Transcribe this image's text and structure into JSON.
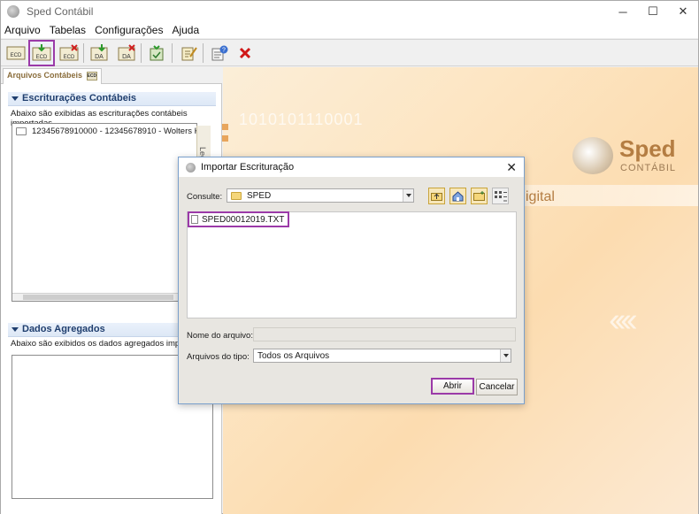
{
  "window": {
    "title": "Sped Contábil",
    "minimize": "─",
    "maximize": "☐",
    "close": "✕"
  },
  "menu": [
    {
      "label": "Arquivo"
    },
    {
      "label": "Tabelas"
    },
    {
      "label": "Configurações"
    },
    {
      "label": "Ajuda"
    }
  ],
  "toolbar": {
    "buttons": [
      {
        "name": "ecd",
        "label": "ECD"
      },
      {
        "name": "ecd-import",
        "label": "ECD"
      },
      {
        "name": "ecd-delete",
        "label": "ECD"
      },
      {
        "name": "da-import",
        "label": "DA"
      },
      {
        "name": "da-delete",
        "label": "DA"
      },
      {
        "name": "validate",
        "label": ""
      },
      {
        "name": "sign",
        "label": ""
      },
      {
        "name": "report",
        "label": ""
      },
      {
        "name": "remove",
        "label": ""
      }
    ]
  },
  "left_panel": {
    "tab_label": "Arquivos Contábeis",
    "tab_badge": "ECD",
    "escrituracoes": {
      "title": "Escriturações Contábeis",
      "description": "Abaixo são exibidas as escriturações contábeis importadas.",
      "items": [
        {
          "text": "12345678910000 - 12345678910 - Wolters Klu"
        }
      ]
    },
    "dados_agregados": {
      "title": "Dados Agregados",
      "description": "Abaixo são exibidos os dados agregados importa"
    },
    "side_handle": "Legenda"
  },
  "right_panel": {
    "binary": "1010101110001",
    "logo_main": "Sped",
    "logo_sub": "CONTÁBIL",
    "digital": "igital",
    "chevrons": "‹‹‹‹"
  },
  "dialog": {
    "title": "Importar Escrituração",
    "consulte_label": "Consulte:",
    "consulte_value": "SPED",
    "files": [
      {
        "name": "SPED00012019.TXT"
      }
    ],
    "nome_label": "Nome do arquivo:",
    "nome_value": "",
    "tipo_label": "Arquivos do tipo:",
    "tipo_value": "Todos os Arquivos",
    "open_button": "Abrir",
    "cancel_button": "Cancelar"
  }
}
